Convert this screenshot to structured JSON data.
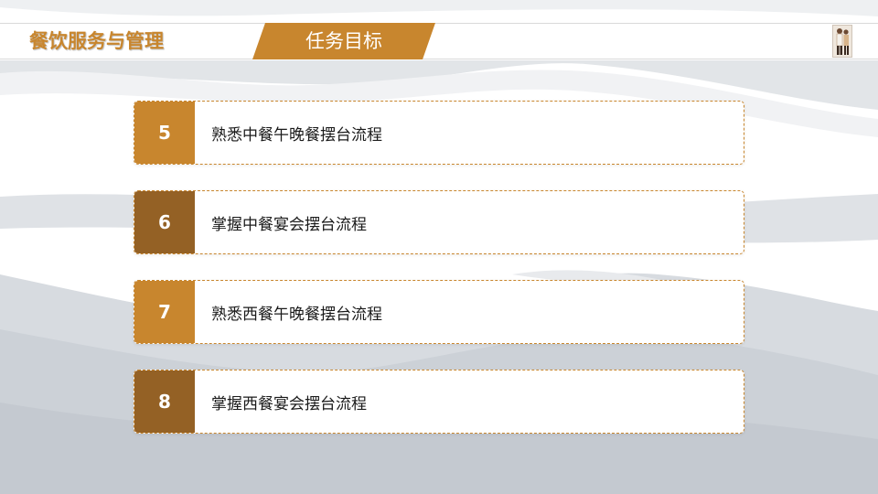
{
  "header": {
    "app_title": "餐饮服务与管理",
    "section_title": "任务目标"
  },
  "colors": {
    "accent_light": "#c8862e",
    "accent_dark": "#946125",
    "wave_gray": "#c9cdd3"
  },
  "goals": [
    {
      "number": "5",
      "text": "熟悉中餐午晚餐摆台流程",
      "style": "light"
    },
    {
      "number": "6",
      "text": "掌握中餐宴会摆台流程",
      "style": "dark"
    },
    {
      "number": "7",
      "text": "熟悉西餐午晚餐摆台流程",
      "style": "light"
    },
    {
      "number": "8",
      "text": "掌握西餐宴会摆台流程",
      "style": "dark"
    }
  ]
}
